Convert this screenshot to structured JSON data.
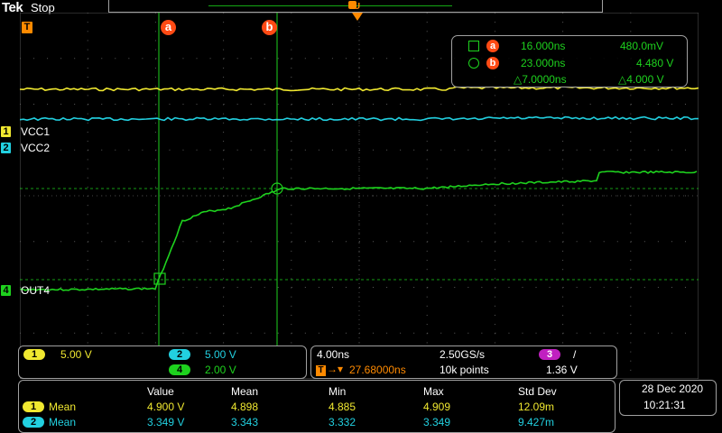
{
  "header": {
    "brand": "Tek",
    "status": "Stop"
  },
  "trigger": {
    "marker_label": "T",
    "position_label": "U"
  },
  "channels": [
    {
      "num": "1",
      "name": "VCC1",
      "color": "#f0e830"
    },
    {
      "num": "2",
      "name": "VCC2",
      "color": "#22d0e0"
    },
    {
      "num": "4",
      "name": "OUT4",
      "color": "#1ed21e"
    }
  ],
  "cursors": {
    "a_label": "a",
    "b_label": "b",
    "a_time": "16.000ns",
    "a_value": "480.0mV",
    "b_time": "23.000ns",
    "b_value": "4.480 V",
    "delta_time": "△7.0000ns",
    "delta_value": "△4.000 V"
  },
  "vertical": {
    "ch1": {
      "num": "1",
      "scale": "5.00 V"
    },
    "ch2": {
      "num": "2",
      "scale": "5.00 V"
    },
    "ch4": {
      "num": "4",
      "scale": "2.00 V"
    }
  },
  "horizontal": {
    "timebase": "4.00ns",
    "sample_rate": "2.50GS/s",
    "trigger_source": "3",
    "trigger_slope": "/",
    "trigger_marker": "T",
    "trigger_position": "27.68000ns",
    "record_length": "10k points",
    "trigger_level": "1.36 V"
  },
  "measurements": {
    "headers": [
      "Value",
      "Mean",
      "Min",
      "Max",
      "Std Dev"
    ],
    "rows": [
      {
        "num": "1",
        "label": "Mean",
        "value": "4.900 V",
        "mean": "4.898",
        "min": "4.885",
        "max": "4.909",
        "std": "12.09m"
      },
      {
        "num": "2",
        "label": "Mean",
        "value": "3.349 V",
        "mean": "3.343",
        "min": "3.332",
        "max": "3.349",
        "std": "9.427m"
      }
    ]
  },
  "clock": {
    "date": "28 Dec  2020",
    "time": "10:21:31"
  },
  "colors": {
    "ch1": "#f0e830",
    "ch2": "#22d0e0",
    "ch3": "#c020c0",
    "ch4": "#1ed21e",
    "cursor": "#ff4a14",
    "trigger": "#ff8a00"
  }
}
